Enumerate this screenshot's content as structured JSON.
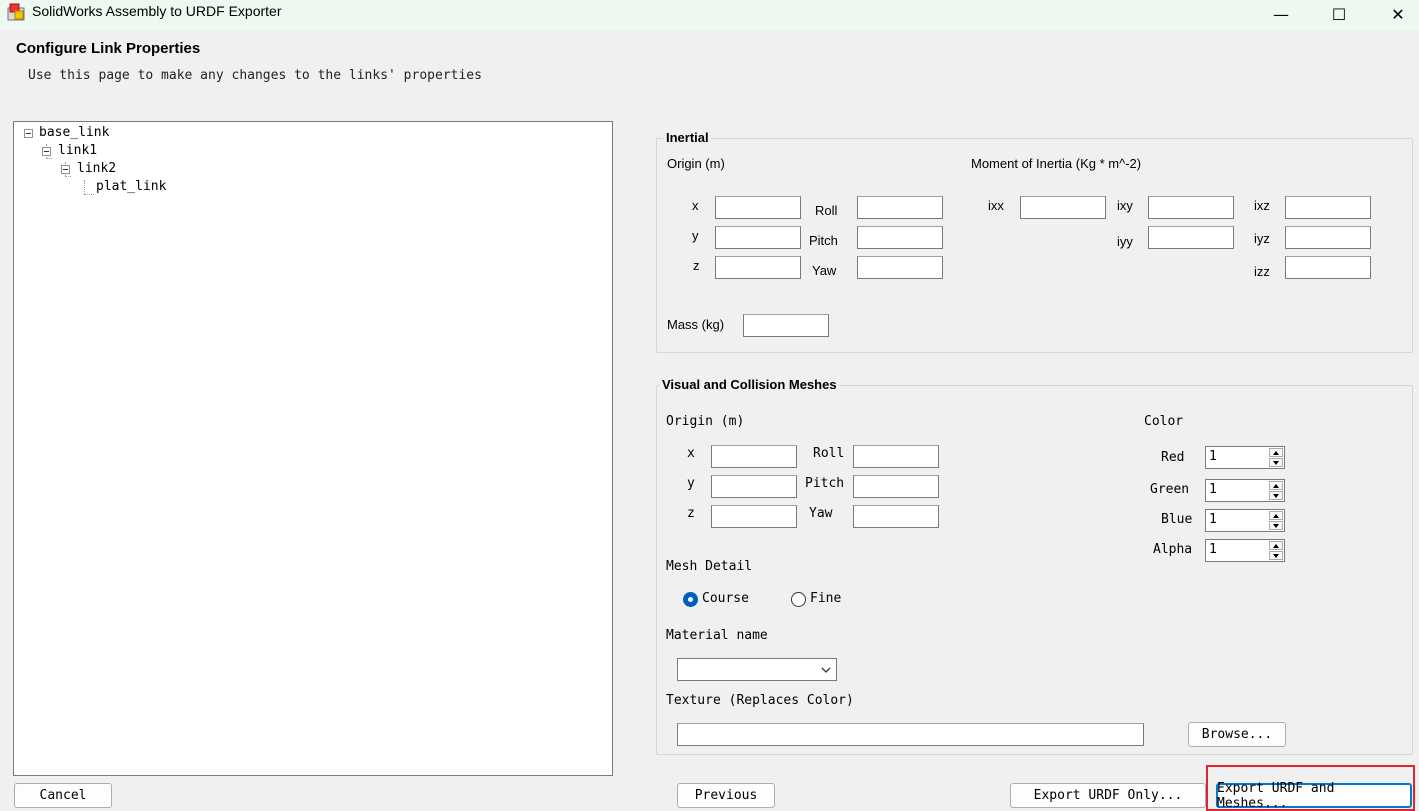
{
  "window": {
    "title": "SolidWorks Assembly to URDF Exporter",
    "minimize": "—",
    "maximize": "☐",
    "close": "✕"
  },
  "page": {
    "title": "Configure Link Properties",
    "subtitle": "Use this page to make any changes to the links' properties"
  },
  "tree": {
    "nodes": [
      "base_link",
      "link1",
      "link2",
      "plat_link"
    ]
  },
  "inertial": {
    "title": "Inertial",
    "origin_label": "Origin (m)",
    "moment_label": "Moment of Inertia (Kg * m^-2)",
    "x": "x",
    "y": "y",
    "z": "z",
    "roll": "Roll",
    "pitch": "Pitch",
    "yaw": "Yaw",
    "ixx": "ixx",
    "ixy": "ixy",
    "ixz": "ixz",
    "iyy": "iyy",
    "iyz": "iyz",
    "izz": "izz",
    "mass_label": "Mass (kg)"
  },
  "visual": {
    "title": "Visual and Collision Meshes",
    "origin_label": "Origin (m)",
    "x": "x",
    "y": "y",
    "z": "z",
    "roll": "Roll",
    "pitch": "Pitch",
    "yaw": "Yaw",
    "color_label": "Color",
    "red_label": "Red",
    "green_label": "Green",
    "blue_label": "Blue",
    "alpha_label": "Alpha",
    "red": "1",
    "green": "1",
    "blue": "1",
    "alpha": "1",
    "mesh_detail_label": "Mesh Detail",
    "course_label": "Course",
    "fine_label": "Fine",
    "mesh_detail_selected": "Course",
    "material_label": "Material name",
    "material_value": "",
    "texture_label": "Texture (Replaces Color)",
    "texture_value": "",
    "browse_label": "Browse..."
  },
  "buttons": {
    "cancel": "Cancel",
    "previous": "Previous",
    "export_urdf_only": "Export URDF Only...",
    "export_urdf_meshes": "Export URDF and Meshes..."
  },
  "colors": {
    "highlight": "#e0252f",
    "radio_selected": "#005fb8"
  }
}
